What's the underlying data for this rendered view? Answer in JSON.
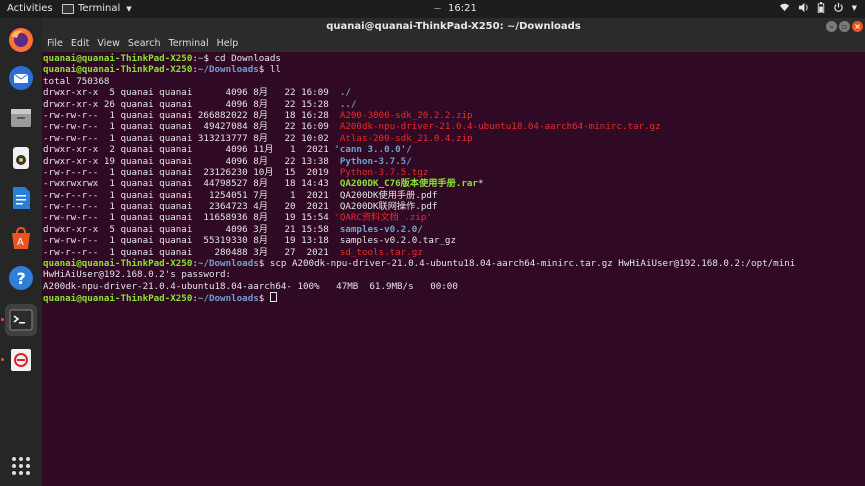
{
  "topbar": {
    "activities": "Activities",
    "app_name": "Terminal",
    "clock": "16:21",
    "icons": [
      "wifi-icon",
      "volume-icon",
      "battery-icon",
      "power-icon"
    ]
  },
  "dock": {
    "items": [
      "firefox-icon",
      "thunderbird-icon",
      "files-icon",
      "rhythmbox-icon",
      "writer-icon",
      "software-icon",
      "help-icon",
      "terminal-icon",
      "app-icon",
      "show-apps-icon"
    ]
  },
  "window": {
    "title": "quanai@quanai-ThinkPad-X250: ~/Downloads",
    "menu": [
      "File",
      "Edit",
      "View",
      "Search",
      "Terminal",
      "Help"
    ]
  },
  "terminal": {
    "lines": [
      [
        {
          "t": "quanai@quanai-ThinkPad-X250",
          "c": "prompt"
        },
        {
          "t": ":"
        },
        {
          "t": "~",
          "c": "path"
        },
        {
          "t": "$ cd Downloads"
        }
      ],
      [
        {
          "t": "quanai@quanai-ThinkPad-X250",
          "c": "prompt"
        },
        {
          "t": ":"
        },
        {
          "t": "~/Downloads",
          "c": "path"
        },
        {
          "t": "$ ll"
        }
      ],
      [
        {
          "t": "total 750368"
        }
      ],
      [
        {
          "t": "drwxr-xr-x  5 quanai quanai      4096 8月   22 16:09  "
        },
        {
          "t": "./",
          "c": "blueb"
        }
      ],
      [
        {
          "t": "drwxr-xr-x 26 quanai quanai      4096 8月   22 15:28  "
        },
        {
          "t": "../",
          "c": "blueb"
        }
      ],
      [
        {
          "t": "-rw-rw-r--  1 quanai quanai 266882022 8月   18 16:28  "
        },
        {
          "t": "A200-3000-sdk_20.2.2.zip",
          "c": "red"
        }
      ],
      [
        {
          "t": "-rw-rw-r--  1 quanai quanai  49427084 8月   22 16:09  "
        },
        {
          "t": "A200dk-npu-driver-21.0.4-ubuntu18.04-aarch64-minirc.tar.gz",
          "c": "red"
        }
      ],
      [
        {
          "t": "-rw-rw-r--  1 quanai quanai 313213777 8月   22 10:02  "
        },
        {
          "t": "Atlas-200-sdk_21.0.4.zip",
          "c": "red"
        }
      ],
      [
        {
          "t": "drwxr-xr-x  2 quanai quanai      4096 11月   1  2021 "
        },
        {
          "t": "'cann 3..0.0'/",
          "c": "blueb"
        }
      ],
      [
        {
          "t": "drwxr-xr-x 19 quanai quanai      4096 8月   22 13:38  "
        },
        {
          "t": "Python-3.7.5/",
          "c": "blueb"
        }
      ],
      [
        {
          "t": "-rw-r--r--  1 quanai quanai  23126230 10月  15  2019  "
        },
        {
          "t": "Python-3.7.5.tgz",
          "c": "red"
        }
      ],
      [
        {
          "t": "-rwxrwxrwx  1 quanai quanai  44798527 8月   18 14:43  "
        },
        {
          "t": "QA200DK_C76版本使用手册.rar",
          "c": "greenb"
        },
        {
          "t": "*"
        }
      ],
      [
        {
          "t": "-rw-r--r--  1 quanai quanai   1254051 7月    1  2021  QA200DK使用手册.pdf"
        }
      ],
      [
        {
          "t": "-rw-r--r--  1 quanai quanai   2364723 4月   20  2021  QA200DK联网操作.pdf"
        }
      ],
      [
        {
          "t": "-rw-rw-r--  1 quanai quanai  11658936 8月   19 15:54 "
        },
        {
          "t": "'QARC资料文档 .zip'",
          "c": "red"
        }
      ],
      [
        {
          "t": "drwxr-xr-x  5 quanai quanai      4096 3月   21 15:58  "
        },
        {
          "t": "samples-v0.2.0/",
          "c": "blueb"
        }
      ],
      [
        {
          "t": "-rw-rw-r--  1 quanai quanai  55319330 8月   19 13:18  samples-v0.2.0.tar_gz"
        }
      ],
      [
        {
          "t": "-rw-r--r--  1 quanai quanai    280488 3月   27  2021  "
        },
        {
          "t": "sd_tools.tar.gz",
          "c": "red"
        }
      ],
      [
        {
          "t": "quanai@quanai-ThinkPad-X250",
          "c": "prompt"
        },
        {
          "t": ":"
        },
        {
          "t": "~/Downloads",
          "c": "path"
        },
        {
          "t": "$ scp A200dk-npu-driver-21.0.4-ubuntu18.04-aarch64-minirc.tar.gz HwHiAiUser@192.168.0.2:/opt/mini"
        }
      ],
      [
        {
          "t": "HwHiAiUser@192.168.0.2's password:"
        }
      ],
      [
        {
          "t": "A200dk-npu-driver-21.0.4-ubuntu18.04-aarch64- 100%   47MB  61.9MB/s   00:00"
        }
      ],
      [
        {
          "t": "quanai@quanai-ThinkPad-X250",
          "c": "prompt"
        },
        {
          "t": ":"
        },
        {
          "t": "~/Downloads",
          "c": "path"
        },
        {
          "t": "$ "
        }
      ]
    ]
  }
}
